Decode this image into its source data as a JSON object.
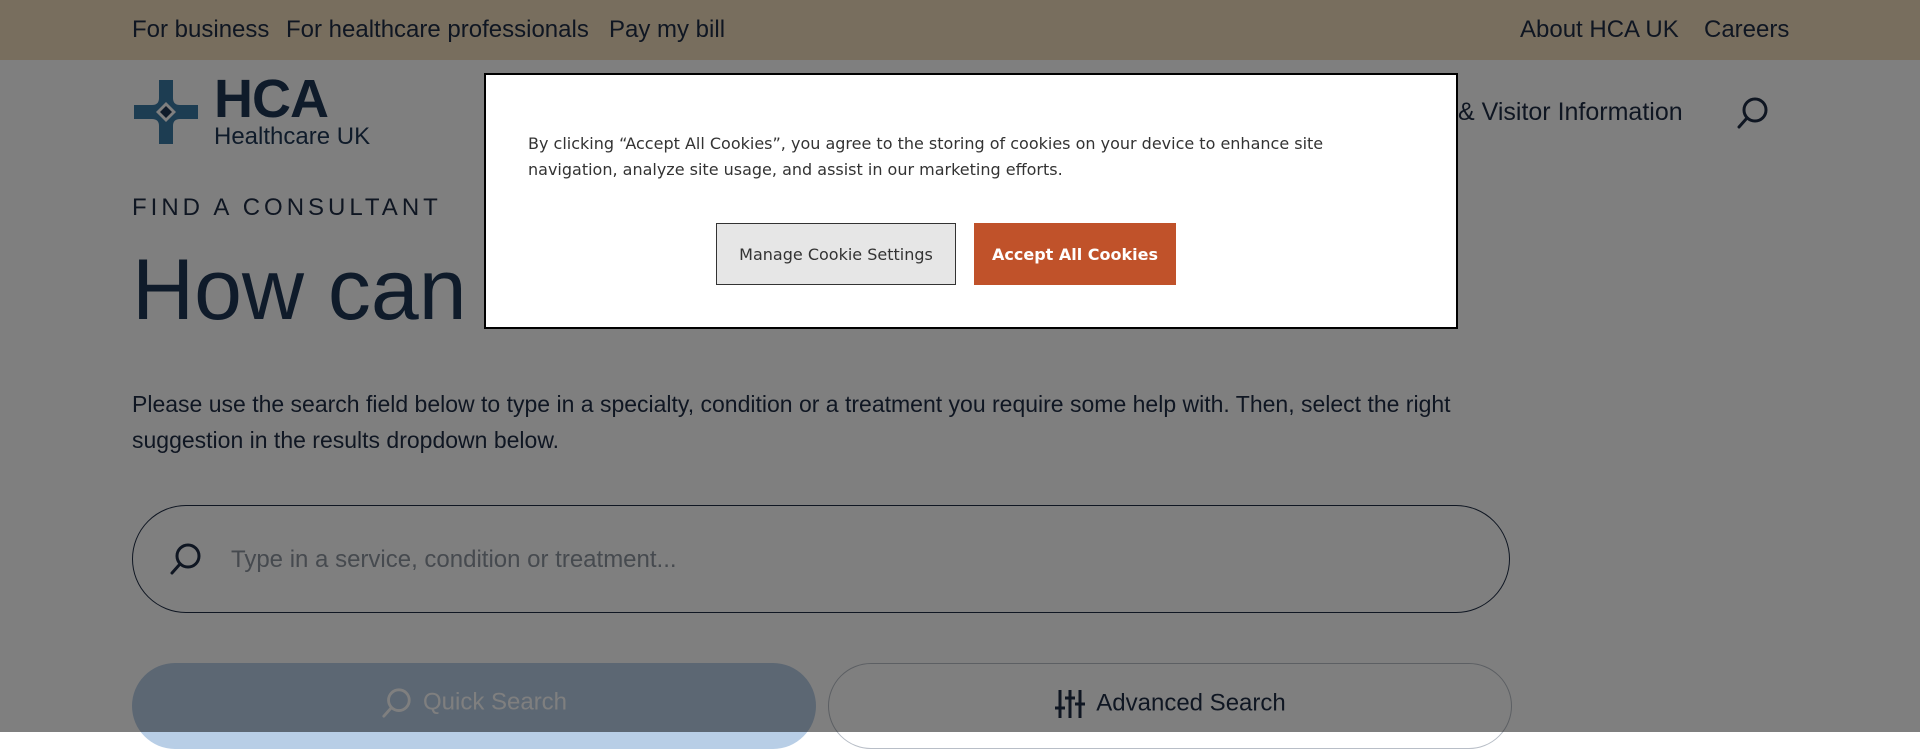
{
  "utility_nav": {
    "left": [
      "For business",
      "For healthcare professionals",
      "Pay my bill"
    ],
    "right": [
      "About HCA UK",
      "Careers"
    ]
  },
  "header": {
    "logo_word": "HCA",
    "logo_sub": "Healthcare UK",
    "nav_visible_text": "& Visitor Information"
  },
  "main": {
    "eyebrow": "FIND A CONSULTANT",
    "hero_title_visible": "How can v",
    "intro": "Please use the search field below to type in a specialty, condition or a treatment you require some help with.  Then, select the right suggestion in the results dropdown below.",
    "search_placeholder": "Type in a service, condition or treatment...",
    "quick_search_label": "Quick Search",
    "advanced_search_label": "Advanced Search"
  },
  "cookie_banner": {
    "text": "By clicking “Accept All Cookies”, you agree to the storing of cookies on your device to enhance site navigation, analyze site usage, and assist in our marketing efforts.",
    "manage_label": "Manage Cookie Settings",
    "accept_label": "Accept All Cookies"
  },
  "colors": {
    "utility_bar": "#f1dcbd",
    "brand_navy": "#1f3754",
    "accept_button": "#c0522a",
    "quick_search_button": "#b8cee6"
  },
  "icons": {
    "header_search": "search-icon",
    "field_search": "search-icon",
    "advanced": "sliders-icon"
  }
}
